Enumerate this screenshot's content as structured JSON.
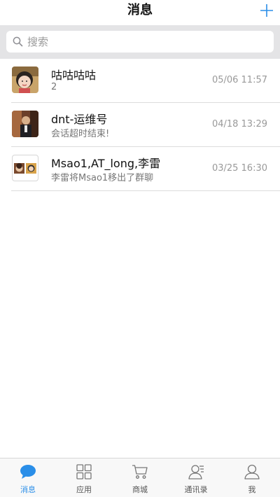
{
  "header": {
    "title": "消息",
    "add_icon": "plus-icon"
  },
  "search": {
    "placeholder": "搜索",
    "icon": "search-icon"
  },
  "conversations": [
    {
      "name": "咕咕咕咕",
      "preview": "2",
      "time": "05/06 11:57"
    },
    {
      "name": "dnt-运维号",
      "preview": "会话超时结束!",
      "time": "04/18 13:29"
    },
    {
      "name": "Msao1,AT_long,李雷",
      "preview": "李雷将Msao1移出了群聊",
      "time": "03/25 16:30"
    }
  ],
  "tabs": [
    {
      "label": "消息",
      "icon": "chat-bubble-icon",
      "active": true
    },
    {
      "label": "应用",
      "icon": "grid-icon",
      "active": false
    },
    {
      "label": "商城",
      "icon": "cart-icon",
      "active": false
    },
    {
      "label": "通讯录",
      "icon": "contacts-icon",
      "active": false
    },
    {
      "label": "我",
      "icon": "person-icon",
      "active": false
    }
  ],
  "colors": {
    "accent": "#2a8ee8",
    "search_band": "#e4e4e6"
  }
}
